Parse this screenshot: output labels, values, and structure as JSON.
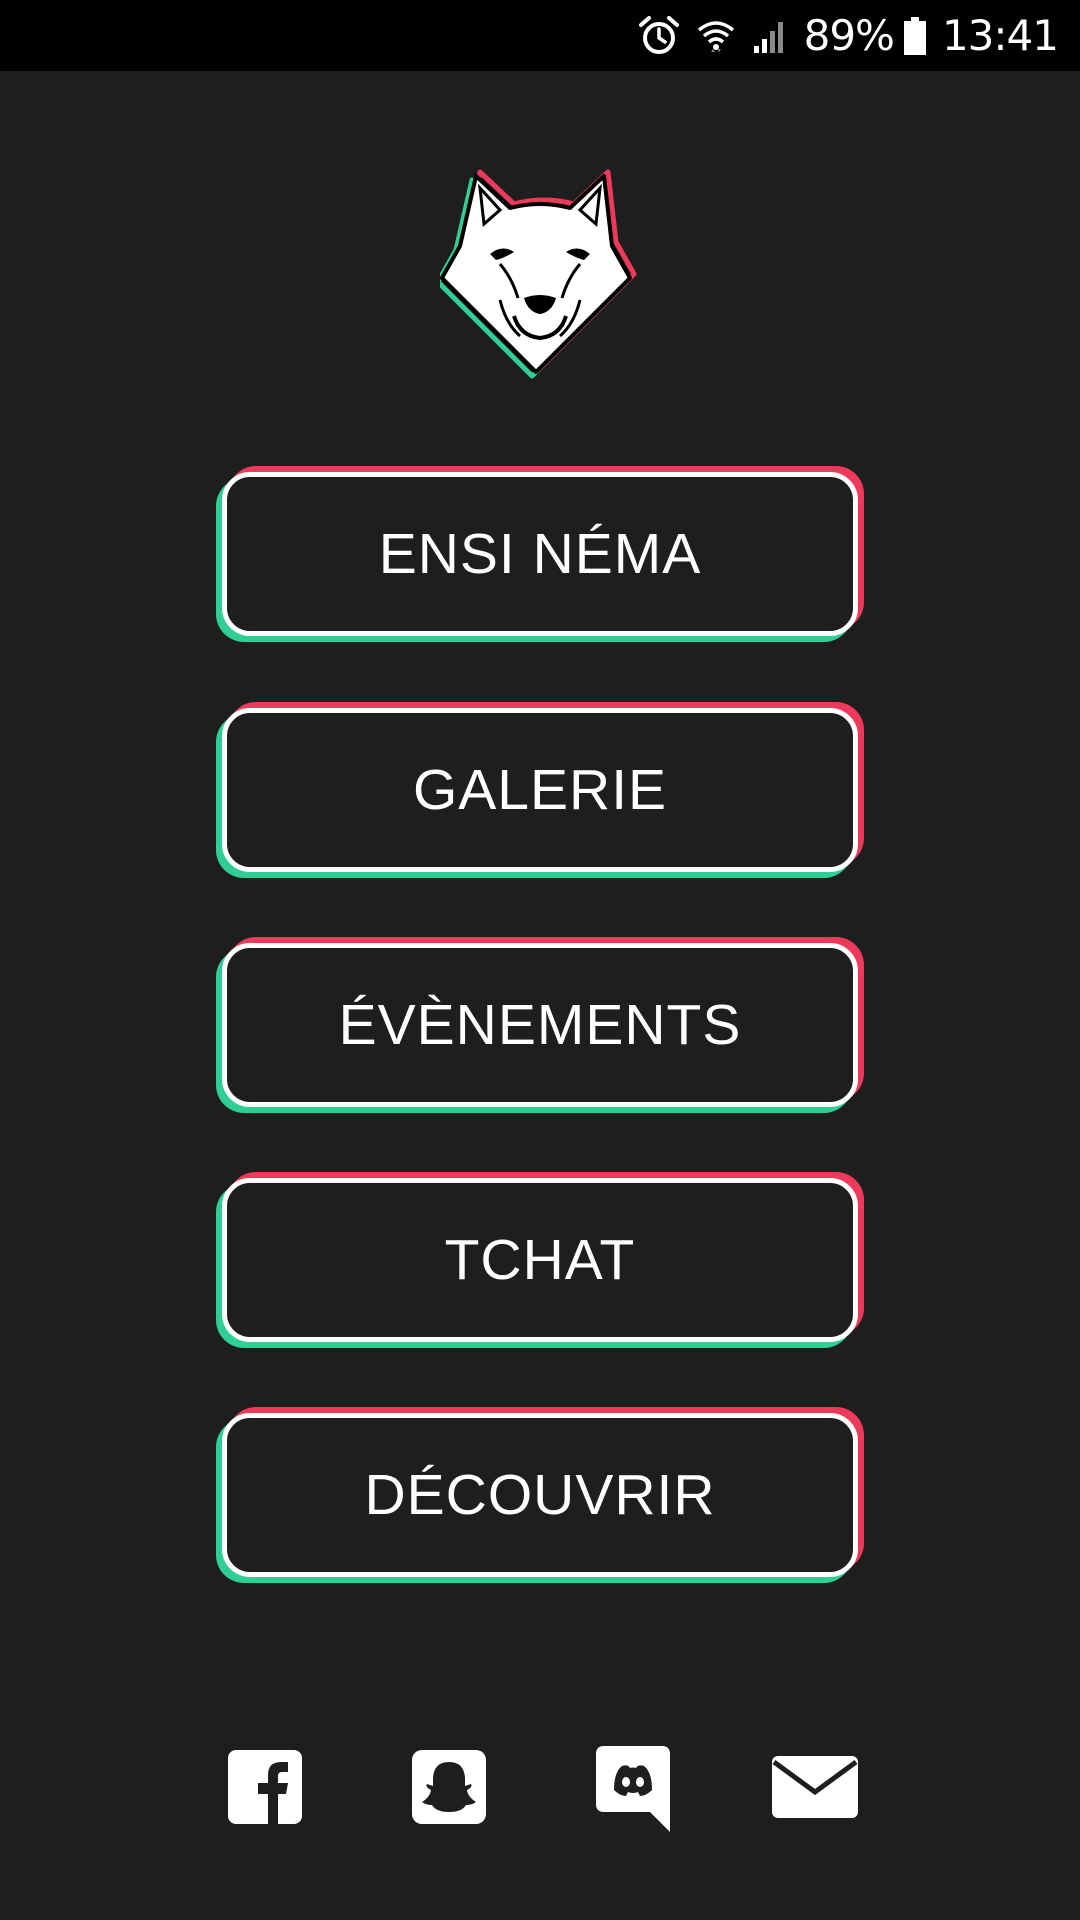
{
  "status_bar": {
    "icons": [
      "alarm-icon",
      "wifi-icon",
      "signal-icon",
      "battery-icon"
    ],
    "battery_percent": "89%",
    "time": "13:41"
  },
  "logo": {
    "icon": "wolf-logo",
    "colors": {
      "outline_green": "#2fcf94",
      "outline_red": "#ee3a5a",
      "fill": "#ffffff"
    }
  },
  "menu": {
    "items": [
      {
        "label": "ENSI NÉMA"
      },
      {
        "label": "GALERIE"
      },
      {
        "label": "ÉVÈNEMENTS"
      },
      {
        "label": "TCHAT"
      },
      {
        "label": "DÉCOUVRIR"
      }
    ]
  },
  "social": {
    "icons": [
      "facebook-icon",
      "snapchat-icon",
      "discord-icon",
      "mail-icon"
    ]
  },
  "theme": {
    "background": "#1e1e1f",
    "accent_green": "#2fcf94",
    "accent_red": "#ee3a5a",
    "text": "#ffffff"
  }
}
